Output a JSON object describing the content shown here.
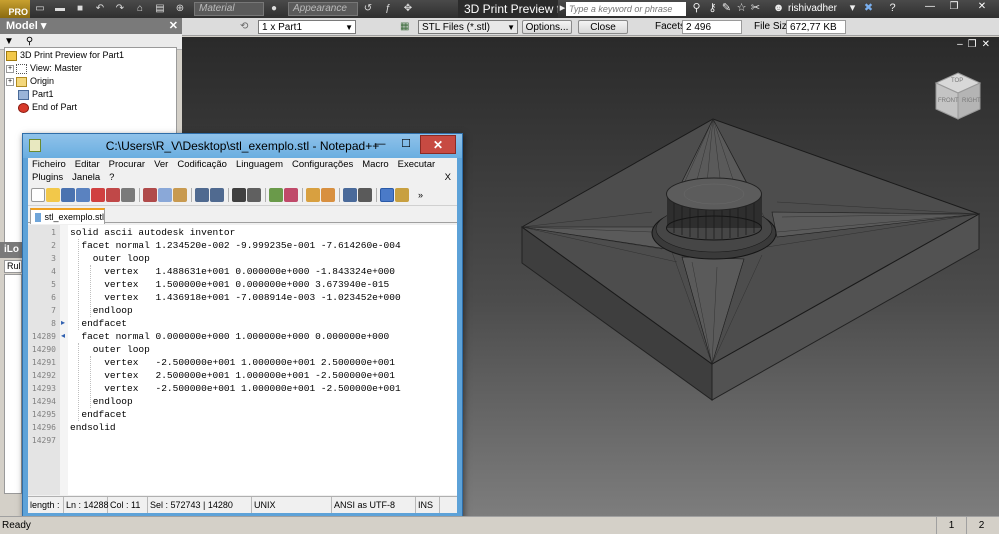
{
  "app": {
    "badge": "PRO",
    "document_title": "3D Print Preview f...",
    "search_placeholder": "Type a keyword or phrase",
    "user": "rishivadher",
    "material_placeholder": "Material",
    "appearance_placeholder": "Appearance"
  },
  "stl_toolbar": {
    "part_select": "1 x Part1",
    "file_type": "STL Files (*.stl)",
    "options_label": "Options...",
    "close_label": "Close",
    "facets_label": "Facets",
    "facets_value": "2 496",
    "filesize_label": "File Size",
    "filesize_value": "672,77 KB"
  },
  "model_browser": {
    "title": "Model",
    "items": [
      {
        "label": "3D Print Preview for Part1"
      },
      {
        "label": "View: Master"
      },
      {
        "label": "Origin"
      },
      {
        "label": "Part1"
      },
      {
        "label": "End of Part"
      }
    ],
    "ilogic_title": "iLo",
    "ilogic_tab": "Rul"
  },
  "viewcube": {
    "top": "TOP",
    "front": "FRONT",
    "right": "RIGHT"
  },
  "notepad": {
    "title": "C:\\Users\\R_V\\Desktop\\stl_exemplo.stl - Notepad++",
    "menu_row1": [
      "Ficheiro",
      "Editar",
      "Procurar",
      "Ver",
      "Codificação",
      "Linguagem",
      "Configurações",
      "Macro",
      "Executar"
    ],
    "menu_row2": [
      "Plugins",
      "Janela",
      "?"
    ],
    "menu_close": "X",
    "tab_label": "stl_exemplo.stl",
    "lines": [
      {
        "no": "1",
        "text": "solid ascii autodesk inventor"
      },
      {
        "no": "2",
        "text": "  facet normal 1.234520e-002 -9.999235e-001 -7.614260e-004"
      },
      {
        "no": "3",
        "text": "    outer loop"
      },
      {
        "no": "4",
        "text": "      vertex   1.488631e+001 0.000000e+000 -1.843324e+000"
      },
      {
        "no": "5",
        "text": "      vertex   1.500000e+001 0.000000e+000 3.673940e-015"
      },
      {
        "no": "6",
        "text": "      vertex   1.436918e+001 -7.008914e-003 -1.023452e+000"
      },
      {
        "no": "7",
        "text": "    endloop"
      },
      {
        "no": "8",
        "text": "  endfacet"
      },
      {
        "no": "14289",
        "text": "  facet normal 0.000000e+000 1.000000e+000 0.000000e+000"
      },
      {
        "no": "14290",
        "text": "    outer loop"
      },
      {
        "no": "14291",
        "text": "      vertex   -2.500000e+001 1.000000e+001 2.500000e+001"
      },
      {
        "no": "14292",
        "text": "      vertex   2.500000e+001 1.000000e+001 -2.500000e+001"
      },
      {
        "no": "14293",
        "text": "      vertex   -2.500000e+001 1.000000e+001 -2.500000e+001"
      },
      {
        "no": "14294",
        "text": "    endloop"
      },
      {
        "no": "14295",
        "text": "  endfacet"
      },
      {
        "no": "14296",
        "text": "endsolid"
      },
      {
        "no": "14297",
        "text": ""
      }
    ],
    "status": {
      "length": "length :",
      "ln": "Ln : 14288",
      "col": "Col : 11",
      "sel": "Sel : 572743 | 14280",
      "eol": "UNIX",
      "encoding": "ANSI as UTF-8",
      "mode": "INS"
    }
  },
  "statusbar": {
    "ready": "Ready",
    "page1": "1",
    "page2": "2"
  },
  "colors": {
    "npp_frame": "#5da2d8",
    "close_red": "#c74a42",
    "tab_accent": "#f0a020"
  }
}
